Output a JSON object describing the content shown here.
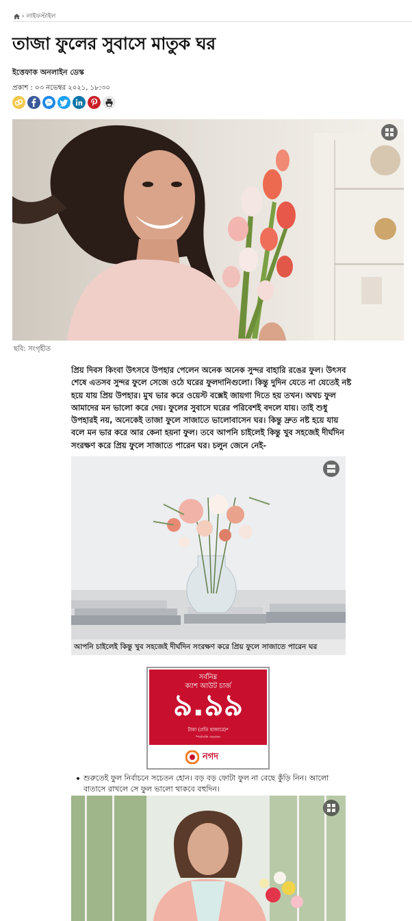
{
  "breadcrumb": {
    "home_icon": "home-icon",
    "separator": "›",
    "section": "লাইফস্টাইল"
  },
  "article": {
    "title": "তাজা ফুলের সুবাসে মাতুক ঘর",
    "author": "ইত্তেফাক অনলাইন ডেস্ক",
    "published": "প্রকাশ : ০৩ নভেম্বর ২০২১, ১৮:৩০"
  },
  "share": [
    {
      "name": "copy-link-icon",
      "color": "#f2c94c"
    },
    {
      "name": "facebook-icon",
      "color": "#3b5998"
    },
    {
      "name": "messenger-icon",
      "color": "#1e88e5"
    },
    {
      "name": "twitter-icon",
      "color": "#1da1f2"
    },
    {
      "name": "linkedin-icon",
      "color": "#0e76a8"
    },
    {
      "name": "pinterest-icon",
      "color": "#cb2027"
    },
    {
      "name": "print-icon",
      "color": "#e0e0e0"
    }
  ],
  "hero": {
    "caption": "ছবি: সংগৃহীত"
  },
  "body_paragraph": "প্রিয় দিবস কিংবা উৎসবে উপহার পেলেন অনেক অনেক সুন্দর বাহারি রঙের ফুল। উৎসব শেষে এতসব সুন্দর ফুলে সেজে ওঠে ঘরের ফুলদানিগুলো। কিন্তু দুদিন যেতে না যেতেই নষ্ট হয়ে যায় প্রিয় উপহার। মুখ ভার করে ওয়েস্ট বক্সেই জায়গা দিতে হয় তখন। অথচ ফুল আমাদের মন ভালো করে দেয়। ফুলের সুবাসে ঘরের পরিবেশই বদলে যায়। তাই শুধু উপহারই নয়, অনেকেই তাজা ফুলে সাজাতে ভালোবাসেন ঘর। কিন্তু দ্রুত নষ্ট হয়ে যায় বলে মন ভার করে আর কেনা হয়না ফুল। তবে আপনি চাইলেই কিন্তু খুব সহজেই দীর্ঘদিন সংরক্ষণ করে প্রিয় ফুলে সাজাতে পারেন ঘর। চলুন জেনে নেই-",
  "image2": {
    "caption": "আপনি চাইলেই কিন্তু খুব সহজেই দীর্ঘদিন সংরক্ষণ করে প্রিয় ফুলে সাজাতে পারেন ঘর"
  },
  "ad": {
    "headline1": "সর্বনিম্ন",
    "headline2": "ক্যাশ আউট চার্জ",
    "rate": "৯.৯৯",
    "unit": "টাকা (প্রতি হাজারে)*",
    "fine_print": "*শর্তাবলি প্রযোজ্য",
    "brand": "নগদ",
    "brand_color": "#c8102e"
  },
  "tips": [
    "শুরুতেই ফুল নির্বাচনে সচেতন হোন। বড় বড় ফোটা ফুল না বেছে কুঁড়ি নিন। আলো বাতাসে রাখলে সে ফুল ভালো থাকবে বহুদিন।"
  ]
}
